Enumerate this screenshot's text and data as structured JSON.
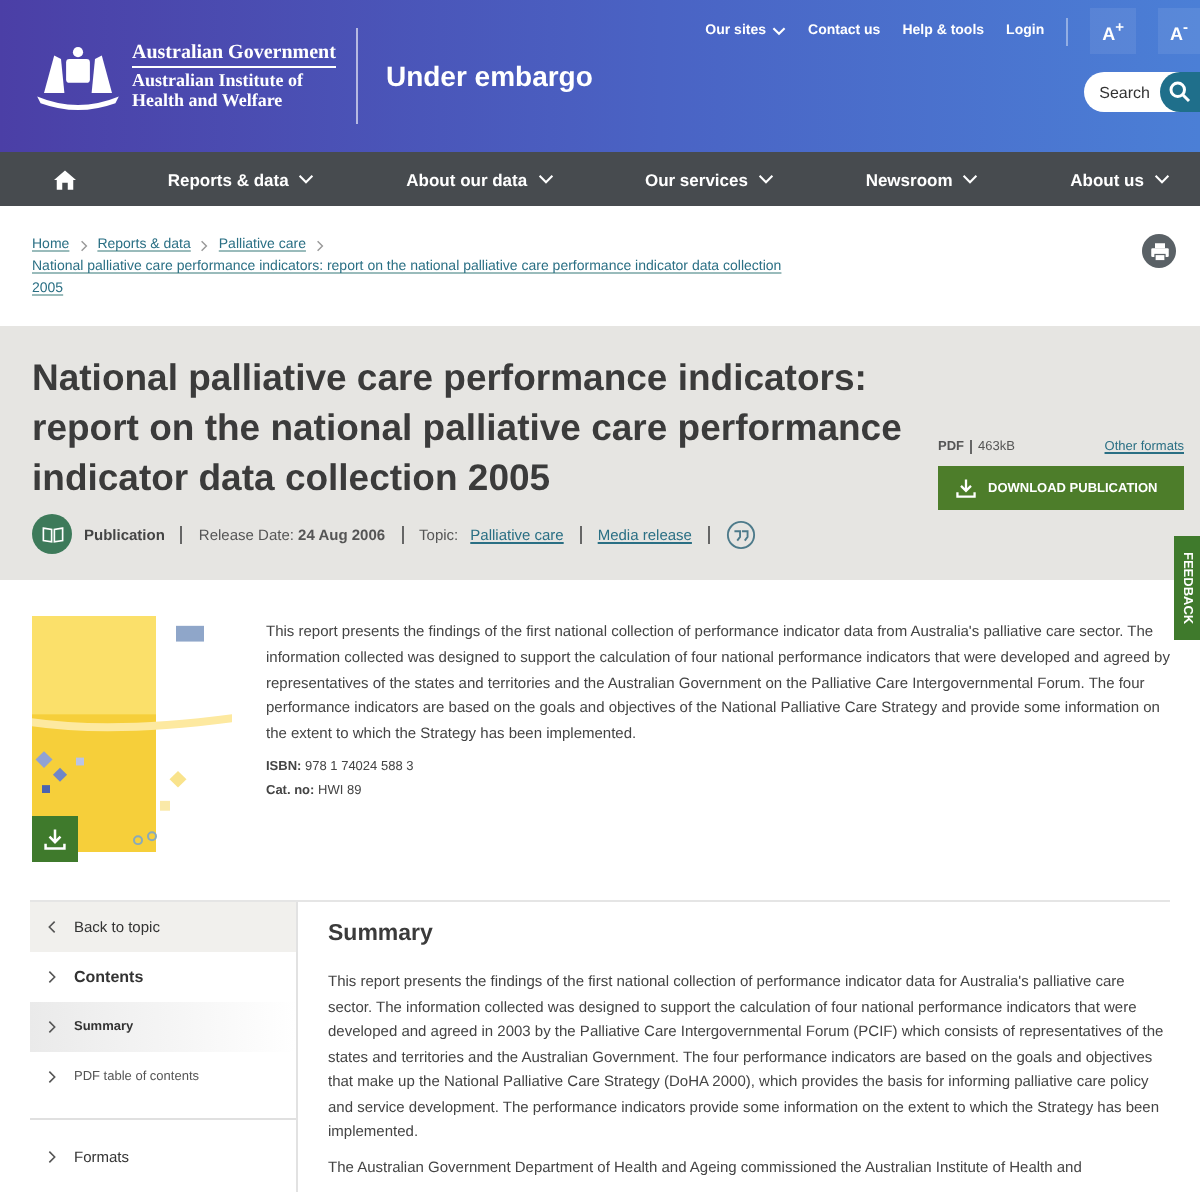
{
  "header": {
    "logo_lines": [
      "Australian Government",
      "Australian Institute of",
      "Health and Welfare"
    ],
    "site_title": "Under embargo",
    "top_links": [
      {
        "label": "Our sites",
        "dropdown": true
      },
      {
        "label": "Contact us",
        "dropdown": false
      },
      {
        "label": "Help & tools",
        "dropdown": false
      },
      {
        "label": "Login",
        "dropdown": false
      }
    ],
    "font_buttons": [
      "A$^{+}$",
      "A$^{-}$"
    ],
    "search": "Search"
  },
  "nav": [
    {
      "kind": "home"
    },
    {
      "kind": "menu",
      "label": "Reports & data"
    },
    {
      "kind": "menu",
      "label": "About our data"
    },
    {
      "kind": "menu",
      "label": "Our services"
    },
    {
      "kind": "menu",
      "label": "Newsroom"
    },
    {
      "kind": "menu",
      "label": "About us"
    }
  ],
  "breadcrumb": [
    "Home",
    "Reports & data",
    "Palliative care",
    "National palliative care performance indicators: report on the national palliative care performance indicator data collection 2005"
  ],
  "title": "National palliative care performance indicators: report on the national palliative care performance indicator data collection 2005",
  "download": {
    "format": "PDF",
    "size": "463kB",
    "other": "Other formats",
    "button": "DOWNLOAD PUBLICATION"
  },
  "meta": {
    "type": "Publication",
    "release_label": "Release Date:",
    "release_date": "24 Aug 2006",
    "topic_label": "Topic:",
    "topic": "Palliative care",
    "media": "Media release"
  },
  "intro": {
    "abstract": "This report presents the findings of the first national collection of performance indicator data from Australia's palliative care sector. The information collected was designed to support the calculation of four national performance indicators that were developed and agreed by representatives of the states and territories and the Australian Government on the Palliative Care Intergovernmental Forum. The four performance indicators are based on the goals and objectives of the National Palliative Care Strategy and provide some information on the extent to which the Strategy has been implemented.",
    "isbn_label": "ISBN:",
    "isbn": "978 1 74024 588 3",
    "cat_label": "Cat. no:",
    "cat": "HWI 89"
  },
  "sidebar": [
    {
      "kind": "back",
      "label": "Back to topic",
      "selected": false
    },
    {
      "kind": "heading",
      "label": "Contents",
      "selected": false
    },
    {
      "kind": "item",
      "label": "Summary",
      "selected": true
    },
    {
      "kind": "item",
      "label": "PDF table of contents",
      "selected": false
    },
    {
      "kind": "divider_heading",
      "label": "Formats",
      "selected": false
    }
  ],
  "summary": {
    "title": "Summary",
    "paragraphs": [
      "This report presents the findings of the first national collection of performance indicator data for Australia's palliative care sector. The information collected was designed to support the calculation of four national performance indicators that were developed and agreed in 2003 by the Palliative Care Intergovernmental Forum (PCIF) which consists of representatives of the states and territories and the Australian Government. The four performance indicators are based on the goals and objectives that make up the National Palliative Care Strategy (DoHA 2000), which provides the basis for informing palliative care policy and service development. The performance indicators provide some information on the extent to which the Strategy has been implemented.",
      "The Australian Government Department of Health and Ageing commissioned the Australian Institute of Health and"
    ]
  },
  "feedback": "FEEDBACK"
}
